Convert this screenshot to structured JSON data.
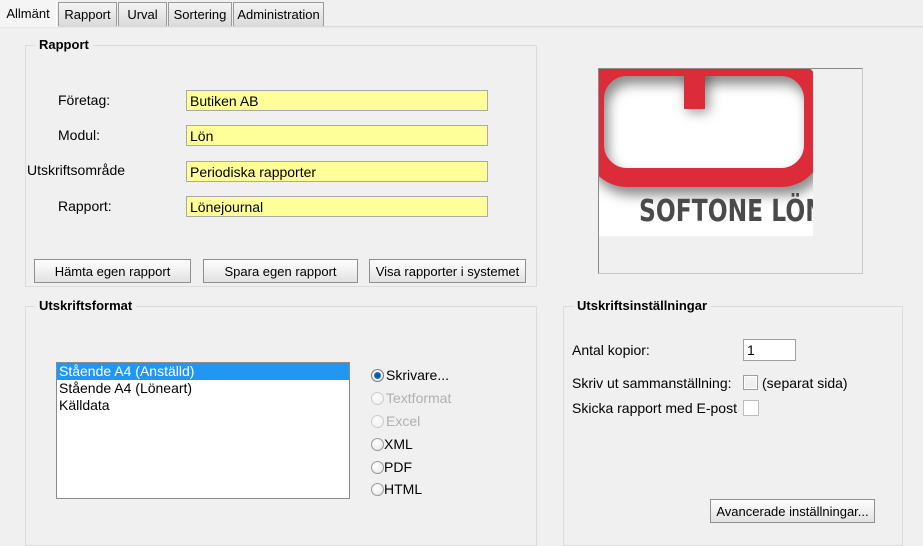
{
  "window": {
    "background_color": "#f0f0f0"
  },
  "tabs": [
    {
      "label": "Allmänt",
      "active": true
    },
    {
      "label": "Rapport",
      "active": false
    },
    {
      "label": "Urval",
      "active": false
    },
    {
      "label": "Sortering",
      "active": false
    },
    {
      "label": "Administration",
      "active": false
    }
  ],
  "report_group": {
    "title": "Rapport",
    "fields": [
      {
        "label": "Företag:",
        "value": "Butiken AB"
      },
      {
        "label": "Modul:",
        "value": "Lön"
      },
      {
        "label": "Utskriftsområde",
        "value": "Periodiska rapporter"
      },
      {
        "label": "Rapport:",
        "value": "Lönejournal"
      }
    ],
    "field_background_color": "#ffff99",
    "buttons": [
      {
        "label": "Hämta egen rapport"
      },
      {
        "label": "Spara egen rapport"
      },
      {
        "label": "Visa rapporter i systemet"
      }
    ]
  },
  "logo": {
    "wordmark": "SOFTONE LÖN",
    "mark_color": "#dc2b39",
    "wordmark_color": "#4a4a4a"
  },
  "print_format_group": {
    "title": "Utskriftsformat",
    "list_items": [
      {
        "label": "Stående A4 (Anställd)",
        "selected": true
      },
      {
        "label": "Stående A4 (Löneart)",
        "selected": false
      },
      {
        "label": "Källdata",
        "selected": false
      }
    ],
    "selection_color": "#2196f3",
    "output_options": [
      {
        "label": "Skrivare...",
        "checked": true,
        "disabled": false,
        "tight": false
      },
      {
        "label": "Textformat",
        "checked": false,
        "disabled": true,
        "tight": false
      },
      {
        "label": "Excel",
        "checked": false,
        "disabled": true,
        "tight": false
      },
      {
        "label": "XML",
        "checked": false,
        "disabled": false,
        "tight": true
      },
      {
        "label": "PDF",
        "checked": false,
        "disabled": false,
        "tight": true
      },
      {
        "label": "HTML",
        "checked": false,
        "disabled": false,
        "tight": true
      }
    ]
  },
  "print_settings_group": {
    "title": "Utskriftsinställningar",
    "copies_label": "Antal kopior:",
    "copies_value": "1",
    "summary_label": "Skriv ut sammanställning:",
    "summary_suffix": "(separat sida)",
    "summary_checked": false,
    "email_label": "Skicka rapport med E-post",
    "email_checked": false,
    "advanced_button": "Avancerade inställningar..."
  }
}
